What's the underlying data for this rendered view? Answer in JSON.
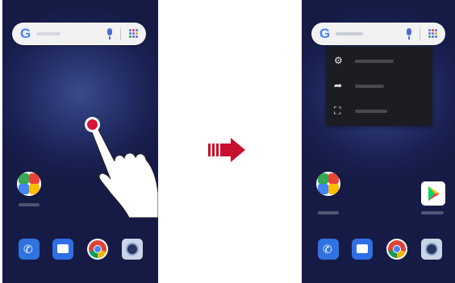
{
  "search": {
    "logo": "G"
  },
  "left_screen": {
    "dock": [
      {
        "name": "phone",
        "icon": "phone-icon"
      },
      {
        "name": "messages",
        "icon": "message-icon"
      },
      {
        "name": "chrome",
        "icon": "chrome-icon"
      },
      {
        "name": "camera",
        "icon": "camera-icon"
      }
    ]
  },
  "right_screen": {
    "context_menu_items": [
      {
        "icon": "gear-icon"
      },
      {
        "icon": "share-icon"
      },
      {
        "icon": "widgets-icon"
      }
    ]
  },
  "colors": {
    "wallpaper": "#1a2152",
    "tap_indicator": "#d7143a",
    "arrow": "#c8102e",
    "context_menu": "#1b1d22"
  }
}
